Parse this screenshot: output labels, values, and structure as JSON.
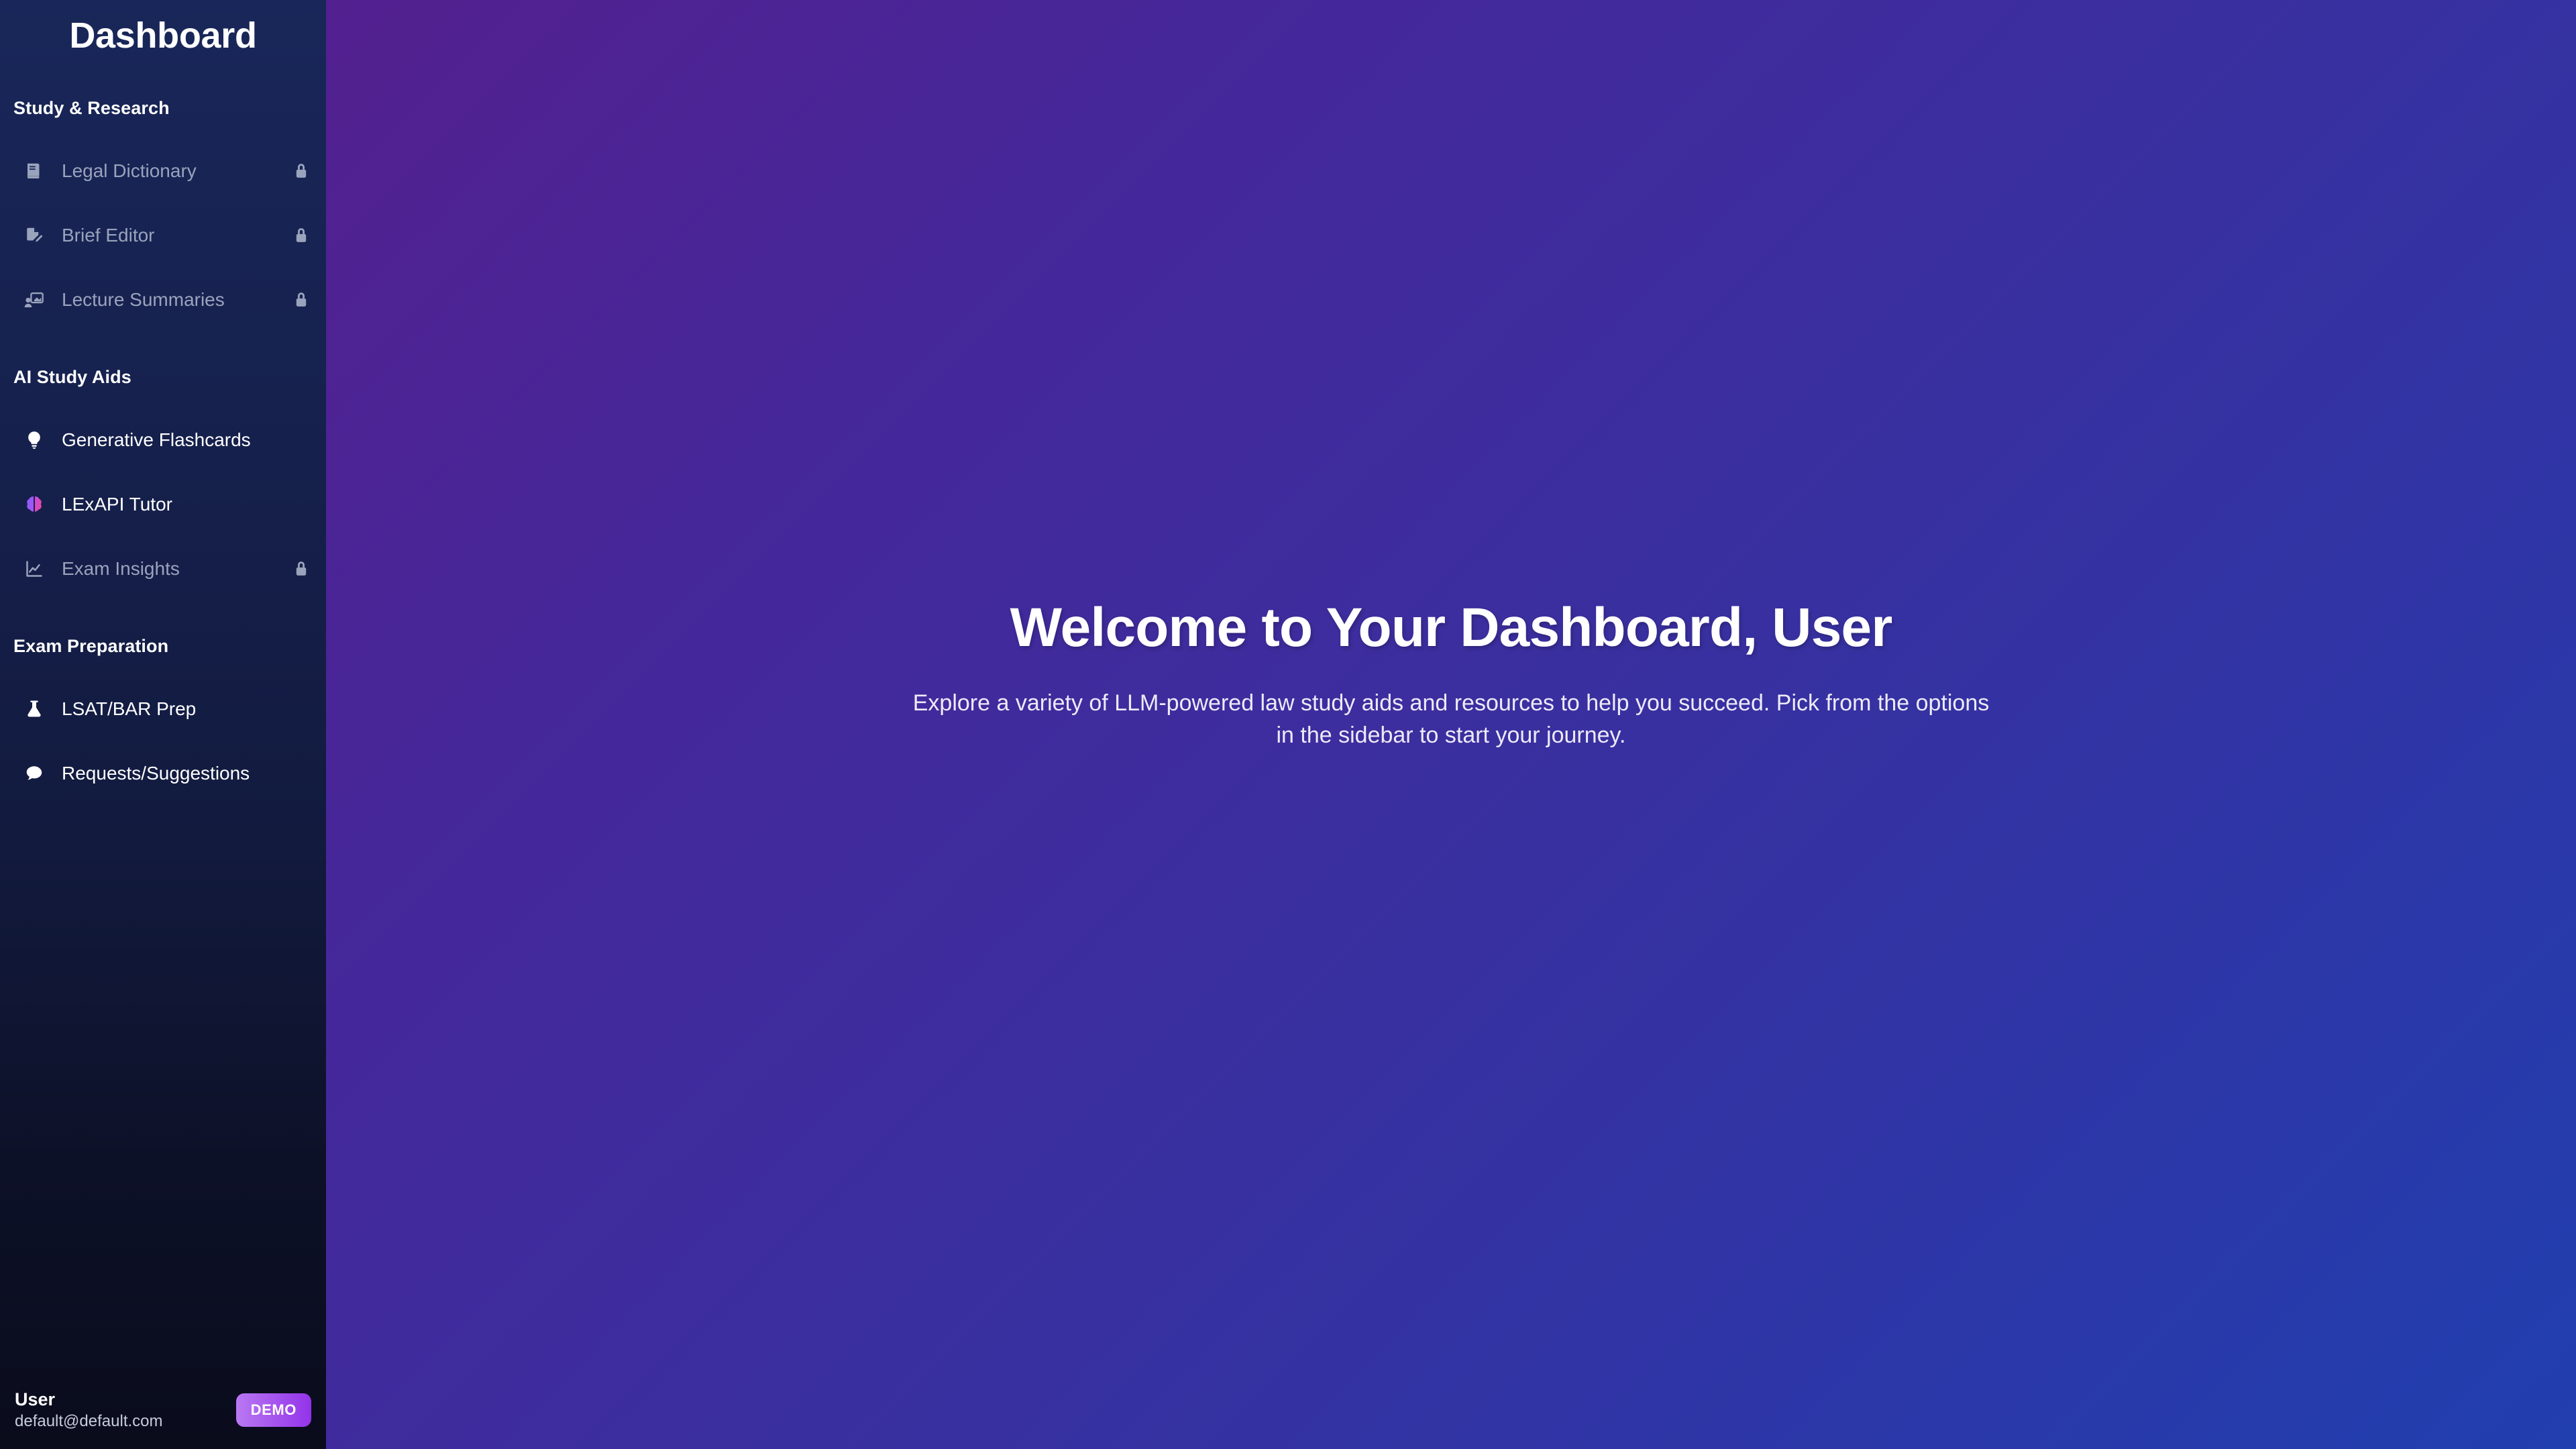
{
  "sidebar": {
    "title": "Dashboard",
    "sections": [
      {
        "label": "Study & Research",
        "items": [
          {
            "label": "Legal Dictionary",
            "icon": "book-icon",
            "locked": true,
            "lock_icon": "lock-icon"
          },
          {
            "label": "Brief Editor",
            "icon": "file-pen-icon",
            "locked": true,
            "lock_icon": "lock-icon"
          },
          {
            "label": "Lecture Summaries",
            "icon": "presentation-person-icon",
            "locked": true,
            "lock_icon": "lock-icon"
          }
        ]
      },
      {
        "label": "AI Study Aids",
        "items": [
          {
            "label": "Generative Flashcards",
            "icon": "lightbulb-icon",
            "locked": false,
            "lock_icon": ""
          },
          {
            "label": "LExAPI Tutor",
            "icon": "brain-icon",
            "locked": false,
            "lock_icon": ""
          },
          {
            "label": "Exam Insights",
            "icon": "line-chart-icon",
            "locked": true,
            "lock_icon": "lock-icon"
          }
        ]
      },
      {
        "label": "Exam Preparation",
        "items": [
          {
            "label": "LSAT/BAR Prep",
            "icon": "flask-icon",
            "locked": false,
            "lock_icon": ""
          },
          {
            "label": "Requests/Suggestions",
            "icon": "speech-bubble-icon",
            "locked": false,
            "lock_icon": ""
          }
        ]
      }
    ],
    "footer": {
      "user_name": "User",
      "user_email": "default@default.com",
      "badge_label": "DEMO"
    }
  },
  "main": {
    "heading": "Welcome to Your Dashboard, User",
    "subheading": "Explore a variety of LLM-powered law study aids and resources to help you succeed. Pick from the options in the sidebar to start your journey."
  },
  "colors": {
    "sidebar_top": "#192659",
    "sidebar_bottom": "#0A0C1C",
    "main_gradient_start": "#53208F",
    "main_gradient_end": "#213FAF",
    "badge_gradient_start": "#B978F2",
    "badge_gradient_end": "#9333EA",
    "locked_text": "#9AA3BC",
    "active_text": "#FFFFFF",
    "brain_left": "#A855F7",
    "brain_right": "#EC4899"
  }
}
